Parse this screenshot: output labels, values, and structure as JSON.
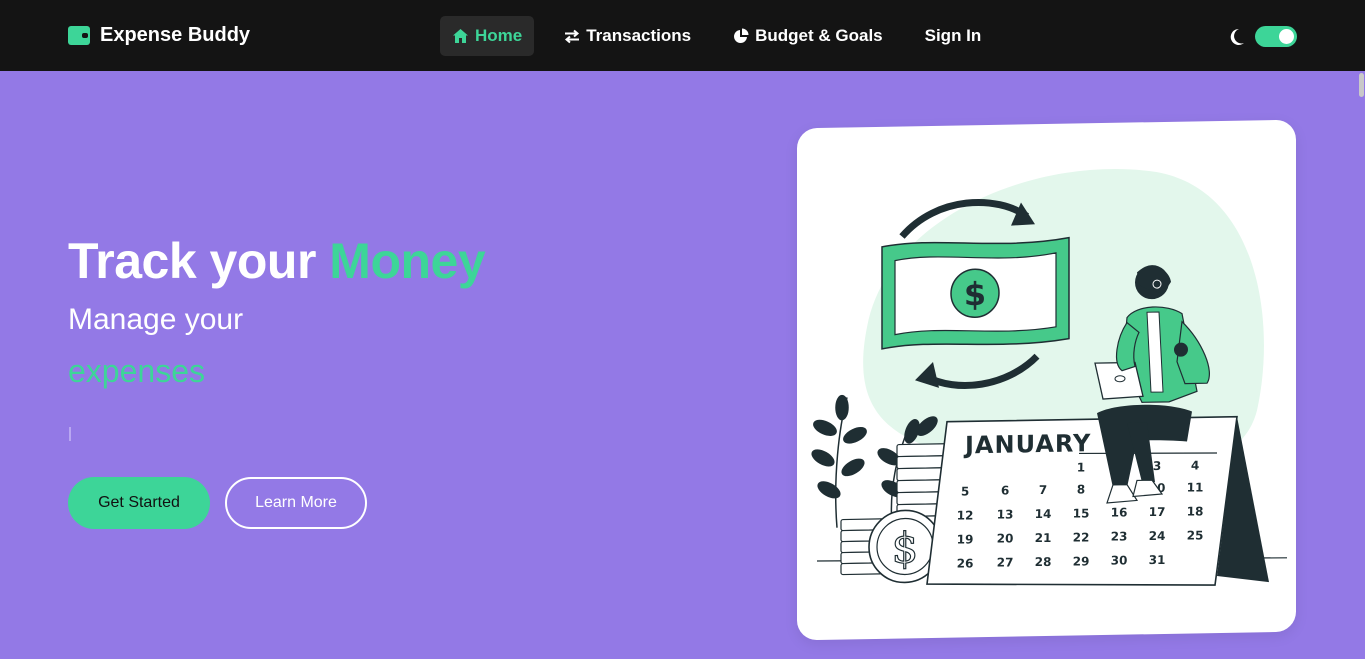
{
  "brand": {
    "name": "Expense Buddy",
    "icon": "wallet-icon"
  },
  "nav": {
    "items": [
      {
        "label": "Home",
        "icon": "home-icon",
        "active": true
      },
      {
        "label": "Transactions",
        "icon": "exchange-icon",
        "active": false
      },
      {
        "label": "Budget & Goals",
        "icon": "pie-chart-icon",
        "active": false
      },
      {
        "label": "Sign In",
        "icon": "",
        "active": false
      }
    ],
    "theme_icon": "moon-icon",
    "theme_toggle_on": true
  },
  "hero": {
    "title_part1": "Track your ",
    "title_accent": "Money",
    "subtitle": "Manage your",
    "typed_word": "expenses",
    "primary_button": "Get Started",
    "secondary_button": "Learn More"
  },
  "illustration": {
    "calendar_month": "JANUARY",
    "calendar_rows": [
      [
        "",
        "",
        "",
        "1",
        "",
        "3",
        "4"
      ],
      [
        "5",
        "6",
        "7",
        "8",
        "",
        "10",
        "11"
      ],
      [
        "12",
        "13",
        "14",
        "15",
        "16",
        "17",
        "18"
      ],
      [
        "19",
        "20",
        "21",
        "22",
        "23",
        "24",
        "25"
      ],
      [
        "26",
        "27",
        "28",
        "29",
        "30",
        "31",
        ""
      ]
    ],
    "bill_symbol": "$",
    "coin_symbol": "$"
  },
  "colors": {
    "accent": "#3dd598",
    "background": "#9379e6",
    "navbar": "#141414",
    "dark_ink": "#1f2e33"
  }
}
